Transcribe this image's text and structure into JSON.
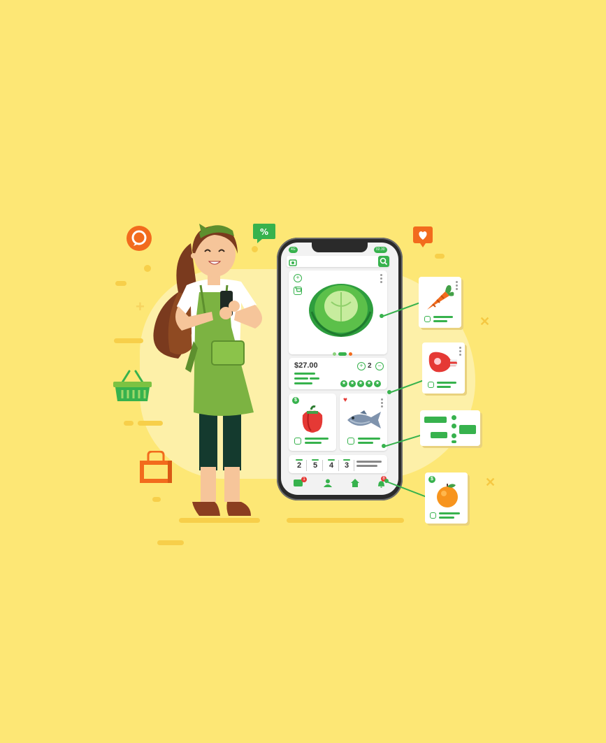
{
  "colors": {
    "background": "#fde775",
    "accent_green": "#37b24d",
    "accent_orange": "#f26b1d",
    "phone_frame": "#2a2a2a"
  },
  "phone": {
    "status_left": "4G",
    "status_right": "02.30",
    "product": {
      "price": "$27.00",
      "quantity": "2",
      "rating_stars": 5
    },
    "counters": [
      "2",
      "5",
      "4",
      "3"
    ],
    "bottom_nav": [
      {
        "icon": "chat-icon",
        "badge": "1"
      },
      {
        "icon": "user-icon"
      },
      {
        "icon": "home-icon"
      },
      {
        "icon": "bell-icon",
        "badge": "8"
      }
    ]
  },
  "icons": [
    "search-bubble-icon",
    "percent-tag-icon",
    "heart-bubble-icon",
    "shopping-basket-icon",
    "shopping-bag-icon",
    "cabbage-icon",
    "bell-pepper-icon",
    "fish-icon",
    "carrot-icon",
    "meat-icon",
    "orange-icon"
  ]
}
